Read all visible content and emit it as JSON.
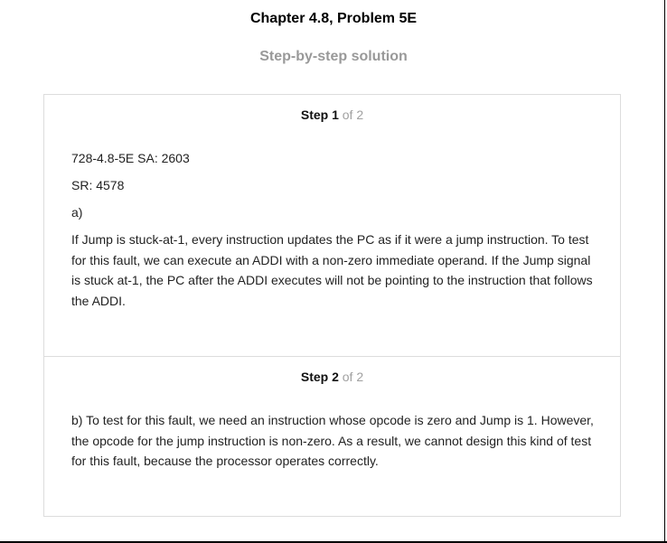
{
  "header": {
    "chapter_title": "Chapter 4.8, Problem 5E",
    "subtitle": "Step-by-step solution"
  },
  "steps": [
    {
      "label": "Step 1",
      "of_text": " of 2",
      "lines": [
        "728-4.8-5E SA: 2603",
        "SR: 4578",
        "a)"
      ],
      "paragraph": "If Jump is stuck-at-1, every instruction updates the PC as if it were a jump instruction. To test for this fault, we can execute an ADDI with a non-zero immediate operand. If the Jump signal is stuck at-1, the PC after the ADDI executes will not be pointing to the instruction that follows the ADDI."
    },
    {
      "label": "Step 2",
      "of_text": " of 2",
      "paragraph": "b) To test for this fault, we need an instruction whose opcode is zero and Jump is 1. However, the opcode for the jump instruction is non-zero. As a result, we cannot design this kind of test for this fault, because the processor operates correctly."
    }
  ]
}
